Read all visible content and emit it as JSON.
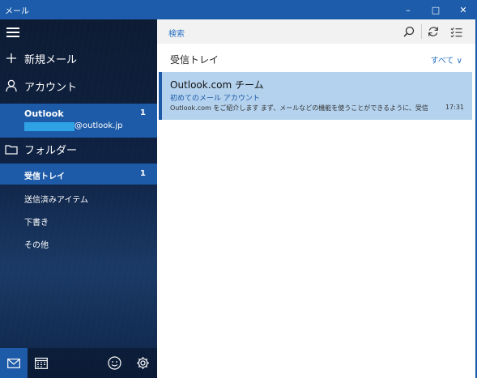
{
  "window": {
    "title": "メール",
    "minimize": "–",
    "maximize": "□",
    "close": "✕"
  },
  "sidebar": {
    "new_mail": "新規メール",
    "accounts": "アカウント",
    "account": {
      "name": "Outlook",
      "unread": "1",
      "email_suffix": "@outlook.jp"
    },
    "folders_header": "フォルダー",
    "folders": [
      {
        "label": "受信トレイ",
        "count": "1"
      },
      {
        "label": "送信済みアイテム"
      },
      {
        "label": "下書き"
      },
      {
        "label": "その他"
      }
    ]
  },
  "toolbar": {
    "search_label": "検索"
  },
  "list": {
    "title": "受信トレイ",
    "filter": "すべて ∨"
  },
  "messages": [
    {
      "sender": "Outlook.com チーム",
      "subject": "初めてのメール アカウント",
      "preview": "Outlook.com をご紹介します まず、メールなどの機能を使うことができるように、受信トレ",
      "time": "17:31"
    }
  ],
  "colors": {
    "titlebar": "#1c5caa",
    "accent": "#1d5aa7",
    "selected_message": "#b4d2ee",
    "link_blue": "#2a72c4"
  }
}
